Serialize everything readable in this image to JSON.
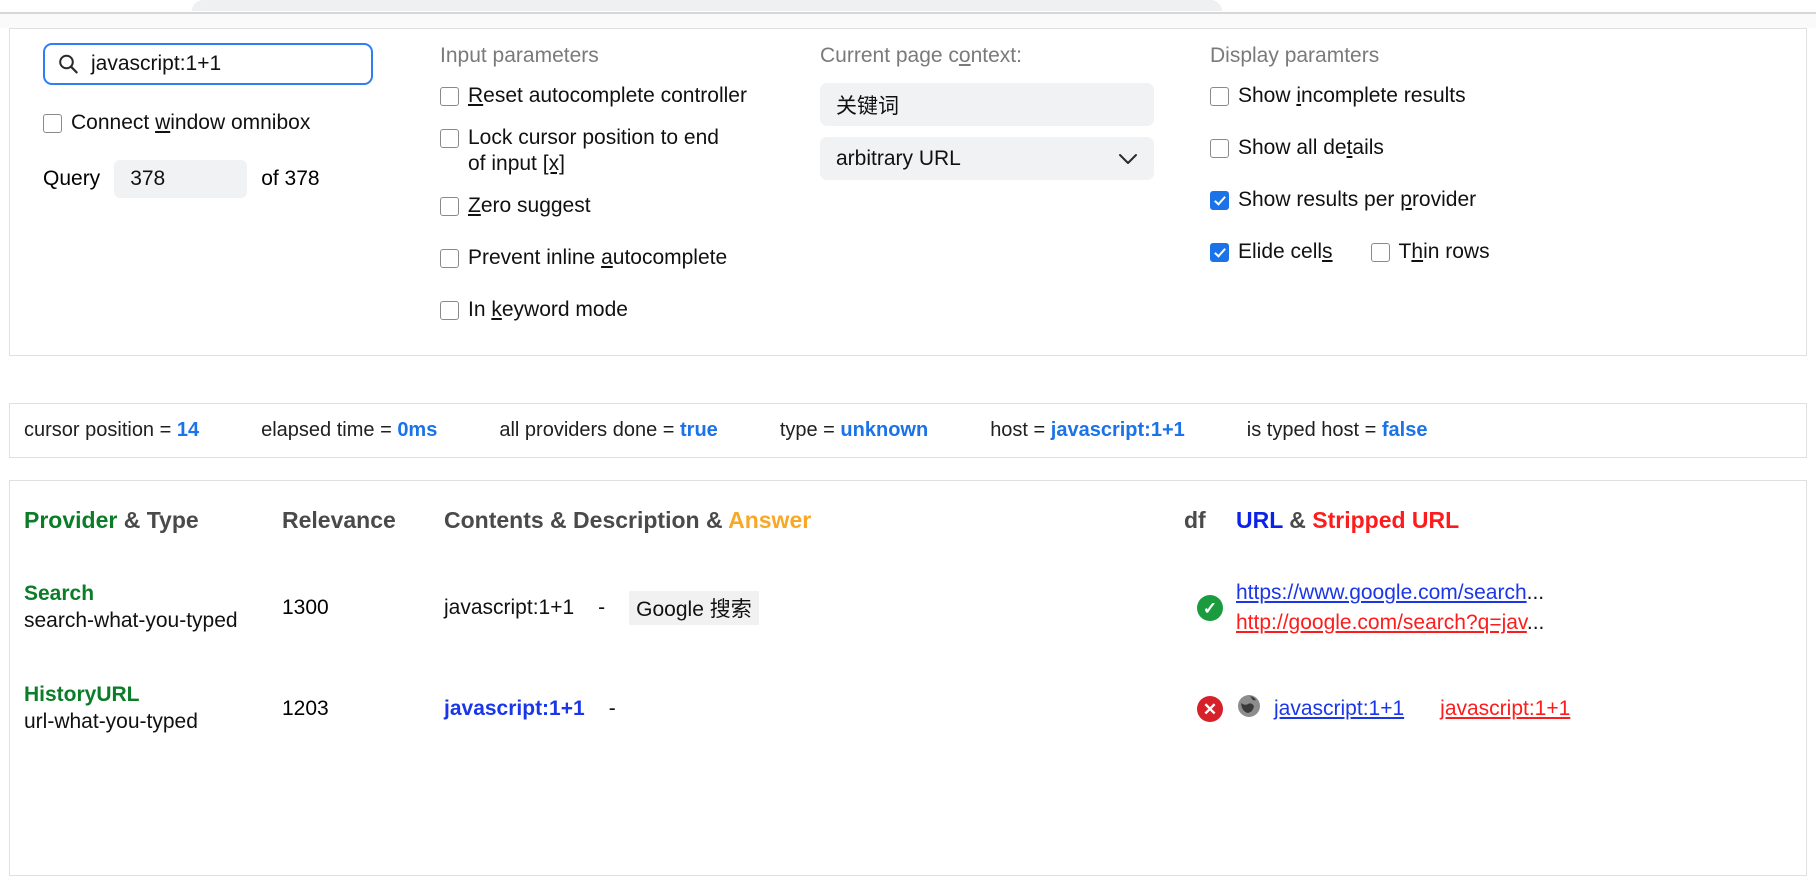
{
  "page": {
    "title": "chrome://omnibox debug page"
  },
  "query_panel": {
    "search_input": {
      "value": "javascript:1+1",
      "icon": "search-icon"
    },
    "connect_window_omnibox": {
      "label_pre": "Connect ",
      "accel": "w",
      "label_post": "indow omnibox",
      "checked": false
    },
    "query_label": "Query",
    "query_index": "378",
    "query_of": "of 378"
  },
  "input_parameters": {
    "title": "Input parameters",
    "items": [
      {
        "pre": "",
        "accel": "R",
        "post": "eset autocomplete controller",
        "checked": false
      },
      {
        "pre": "",
        "accel": "",
        "post": "Lock cursor position to end of input [x]",
        "checked": false
      },
      {
        "pre": "",
        "accel": "Z",
        "post": "ero suggest",
        "checked": false
      },
      {
        "pre": "Prevent inline ",
        "accel": "a",
        "post": "utocomplete",
        "checked": false
      },
      {
        "pre": "In ",
        "accel": "k",
        "post": "eyword mode",
        "checked": false
      }
    ]
  },
  "page_context": {
    "title": "Current page context:",
    "url_field": {
      "value": "关键词"
    },
    "type_select": {
      "value": "arbitrary URL",
      "icon": "chevron-down-icon"
    }
  },
  "display_parameters": {
    "title": "Display paramters",
    "items": [
      {
        "pre": "Show ",
        "accel": "i",
        "post": "ncomplete results",
        "checked": false
      },
      {
        "pre": "Show all de",
        "accel": "t",
        "post": "ails",
        "checked": false
      },
      {
        "pre": "Show results per ",
        "accel": "p",
        "post": "rovider",
        "checked": true
      },
      {
        "pre": "Elide cell",
        "accel": "s",
        "post": "",
        "checked": true
      },
      {
        "pre": "T",
        "accel": "h",
        "post": "in rows",
        "checked": false
      }
    ]
  },
  "status_bar": [
    {
      "label": "cursor position = ",
      "value": "14"
    },
    {
      "label": "elapsed time = ",
      "value": "0ms"
    },
    {
      "label": "all providers done = ",
      "value": "true"
    },
    {
      "label": "type = ",
      "value": "unknown"
    },
    {
      "label": "host = ",
      "value": "javascript:1+1"
    },
    {
      "label": "is typed host = ",
      "value": "false"
    }
  ],
  "results_table": {
    "headers": {
      "provider": "Provider",
      "amp1": " & ",
      "type": "Type",
      "relevance": "Relevance",
      "contents": "Contents & Description & ",
      "answer": "Answer",
      "df": "df",
      "url": "URL",
      "amp2": " & ",
      "stripped_url": "Stripped URL"
    },
    "rows": [
      {
        "provider": "Search",
        "type": "search-what-you-typed",
        "relevance": "1300",
        "contents": "javascript:1+1",
        "contents_is_link": false,
        "dash": "-",
        "description": "Google 搜索",
        "df_status": "ok",
        "df_glyph": "✓",
        "has_globe": false,
        "url": "https://www.google.com/search",
        "url_ellipsis": "...",
        "stripped_url": "http://google.com/search?q=jav",
        "stripped_ellipsis": "...",
        "stripped_inline": false
      },
      {
        "provider": "HistoryURL",
        "type": "url-what-you-typed",
        "relevance": "1203",
        "contents": "javascript:1+1",
        "contents_is_link": true,
        "dash": "-",
        "description": "",
        "df_status": "bad",
        "df_glyph": "✕",
        "has_globe": true,
        "url": "javascript:1+1",
        "url_ellipsis": "",
        "stripped_url": "javascript:1+1",
        "stripped_ellipsis": "",
        "stripped_inline": true
      }
    ]
  },
  "colors": {
    "accent_blue": "#1a73e8",
    "link_blue": "#1a36e8",
    "link_red": "#fc1c1c",
    "provider_green": "#0b7d28",
    "answer_orange": "#f9a825",
    "status_ok": "#1a9c3e",
    "status_bad": "#d6202a"
  }
}
